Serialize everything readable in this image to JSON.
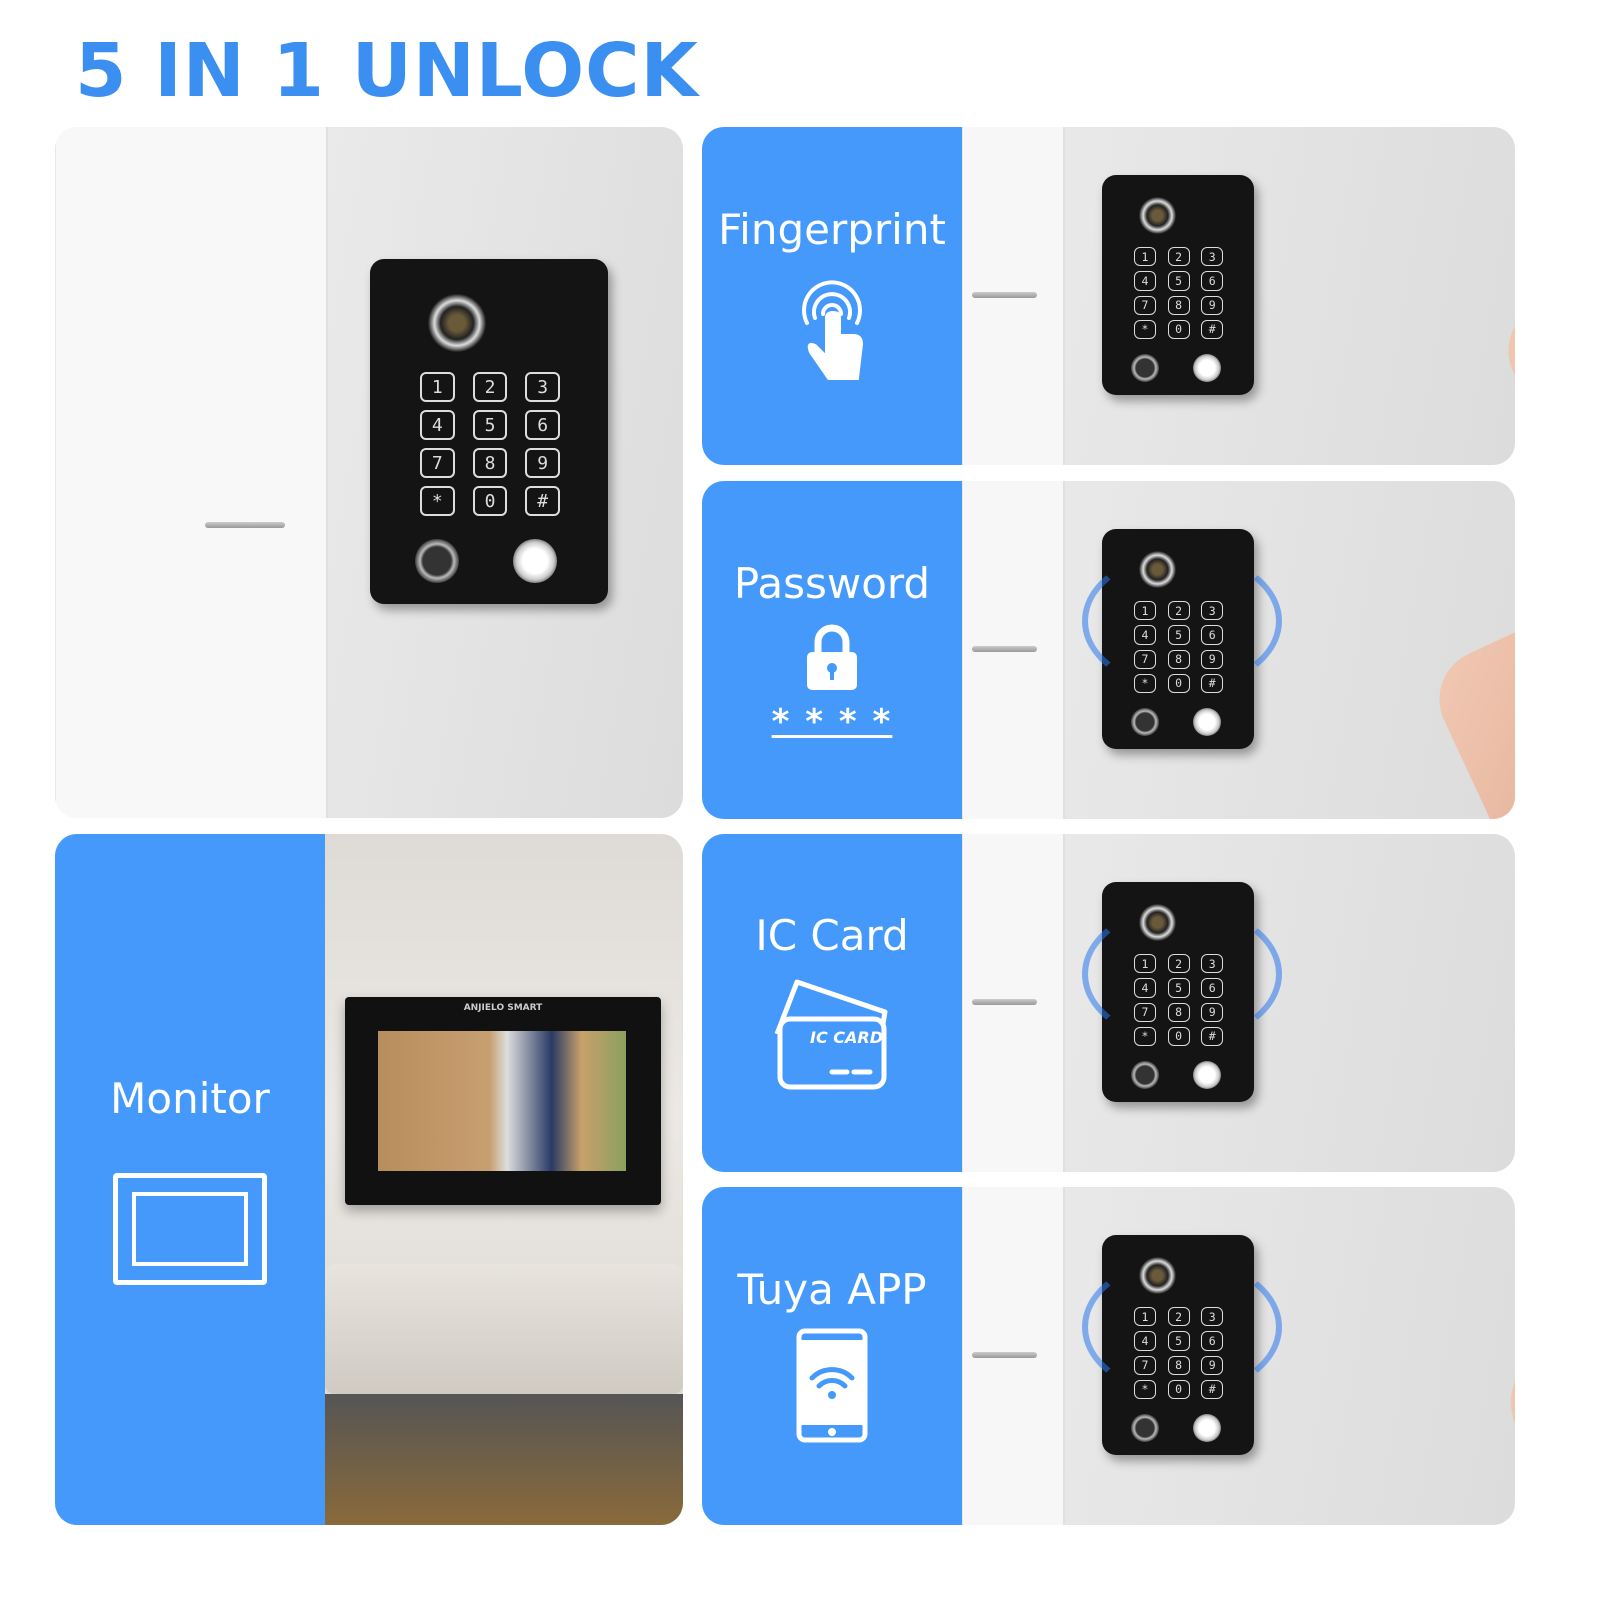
{
  "title": "5 IN 1 UNLOCK",
  "keypad": [
    "1",
    "2",
    "3",
    "4",
    "5",
    "6",
    "7",
    "8",
    "9",
    "*",
    "0",
    "#"
  ],
  "methods": [
    {
      "label": "Fingerprint",
      "icon": "fingerprint-touch-icon"
    },
    {
      "label": "Password",
      "icon": "padlock-icon",
      "mask": "* * * *"
    },
    {
      "label": "IC Card",
      "icon": "ic-card-icon",
      "card_text": "IC CARD"
    },
    {
      "label": "Tuya APP",
      "icon": "smartphone-wifi-icon"
    }
  ],
  "monitor": {
    "label": "Monitor",
    "icon": "monitor-icon",
    "brand": "ANJIELO SMART"
  },
  "colors": {
    "accent": "#4499fb",
    "title": "#3b8ff0"
  }
}
